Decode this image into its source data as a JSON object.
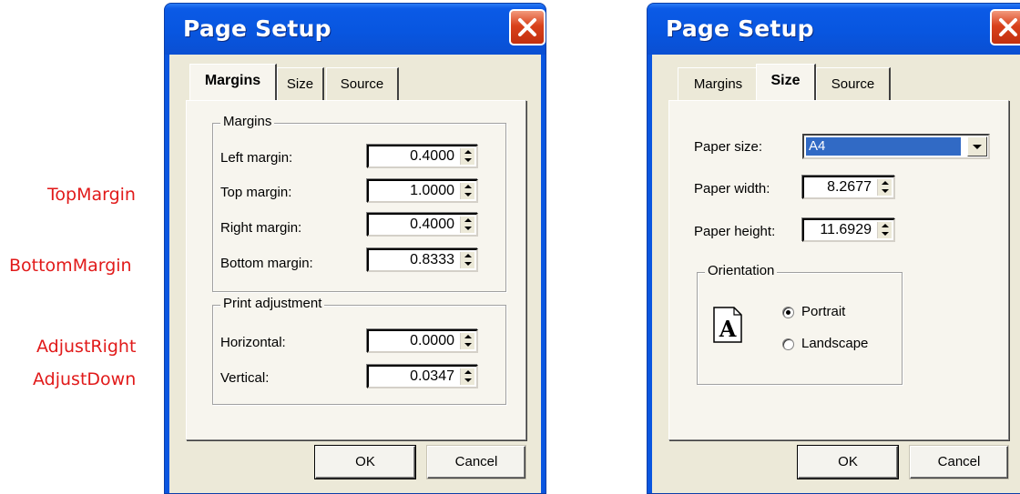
{
  "annotations": [
    "TopMargin",
    "BottomMargin",
    "AdjustRight",
    "AdjustDown"
  ],
  "colors": {
    "annotation": "#e11a1a",
    "titlebar": "#0856e0",
    "close_button": "#d9411b",
    "dialog_face": "#ece9d8",
    "selection": "#316ac5"
  },
  "dialog_margins": {
    "title": "Page Setup",
    "tabs": [
      "Margins",
      "Size",
      "Source"
    ],
    "active_tab": "Margins",
    "margins_group": {
      "label": "Margins",
      "fields": [
        {
          "label": "Left margin:",
          "value": "0.4000"
        },
        {
          "label": "Top margin:",
          "value": "1.0000"
        },
        {
          "label": "Right margin:",
          "value": "0.4000"
        },
        {
          "label": "Bottom margin:",
          "value": "0.8333"
        }
      ]
    },
    "adjust_group": {
      "label": "Print adjustment",
      "fields": [
        {
          "label": "Horizontal:",
          "value": "0.0000"
        },
        {
          "label": "Vertical:",
          "value": "0.0347"
        }
      ]
    },
    "ok_label": "OK",
    "cancel_label": "Cancel"
  },
  "dialog_size": {
    "title": "Page Setup",
    "tabs": [
      "Margins",
      "Size",
      "Source"
    ],
    "active_tab": "Size",
    "paper_size": {
      "label": "Paper size:",
      "value": "A4"
    },
    "paper_width": {
      "label": "Paper width:",
      "value": "8.2677"
    },
    "paper_height": {
      "label": "Paper height:",
      "value": "11.6929"
    },
    "orientation": {
      "label": "Orientation",
      "icon_letter": "A",
      "portrait_label": "Portrait",
      "landscape_label": "Landscape",
      "selected": "Portrait"
    },
    "ok_label": "OK",
    "cancel_label": "Cancel"
  }
}
